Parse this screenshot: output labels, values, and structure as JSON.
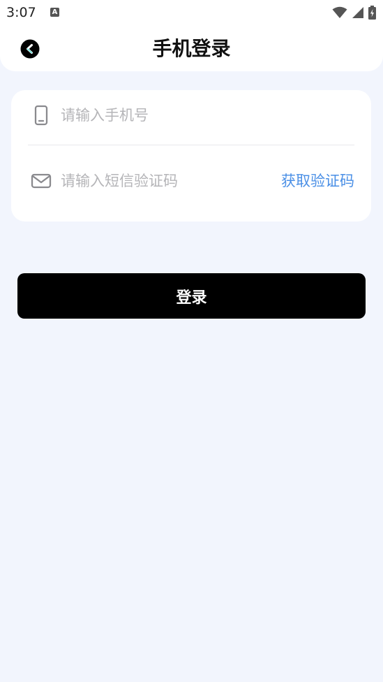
{
  "status_bar": {
    "time": "3:07",
    "notification_icon": "text-a-icon",
    "icons": [
      "wifi-icon",
      "signal-icon",
      "battery-charging-icon"
    ]
  },
  "header": {
    "title": "手机登录",
    "back_icon": "back-arrow-icon"
  },
  "form": {
    "phone": {
      "icon": "phone-icon",
      "placeholder": "请输入手机号",
      "value": ""
    },
    "code": {
      "icon": "mail-icon",
      "placeholder": "请输入短信验证码",
      "value": "",
      "get_code_label": "获取验证码"
    }
  },
  "login_button": {
    "label": "登录"
  },
  "colors": {
    "background": "#f2f5fd",
    "accent_link": "#4a8fe6",
    "primary_button": "#000000",
    "back_arrow_accent": "#4fe0d6"
  }
}
